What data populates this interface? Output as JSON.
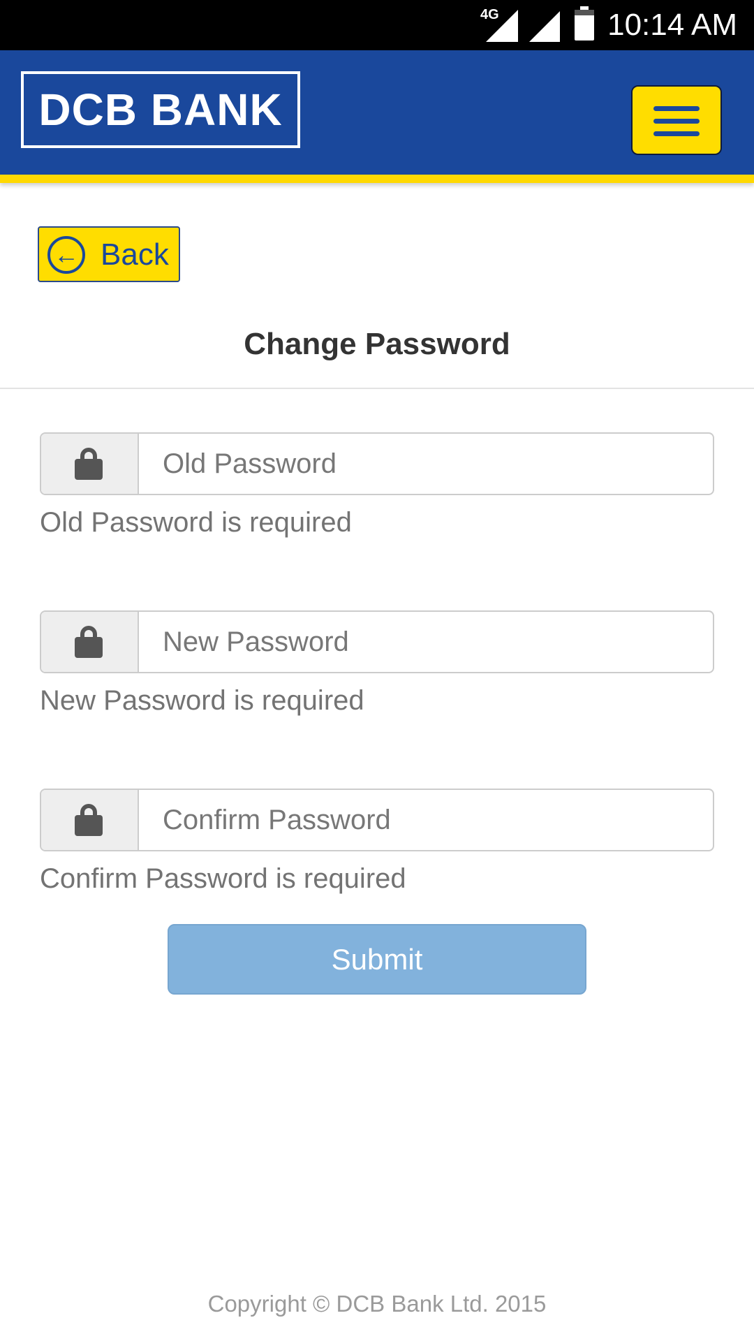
{
  "status_bar": {
    "network_label": "4G",
    "time": "10:14 AM",
    "icons": [
      "signal-4g-icon",
      "signal-icon",
      "battery-icon"
    ]
  },
  "header": {
    "logo_text": "DCB BANK",
    "menu_icon": "hamburger-menu-icon",
    "brand_color": "#1a489c",
    "accent_color": "#ffdd00"
  },
  "back_button": {
    "label": "Back",
    "icon": "arrow-left-circle-icon"
  },
  "page_title": "Change Password",
  "form": {
    "fields": [
      {
        "placeholder": "Old Password",
        "value": "",
        "icon": "lock-icon",
        "error": "Old Password is required"
      },
      {
        "placeholder": "New Password",
        "value": "",
        "icon": "lock-icon",
        "error": "New Password is required"
      },
      {
        "placeholder": "Confirm Password",
        "value": "",
        "icon": "lock-icon",
        "error": "Confirm Password is required"
      }
    ],
    "submit_label": "Submit",
    "submit_color": "#82b2dc"
  },
  "footer": {
    "copyright": "Copyright © DCB Bank Ltd. 2015"
  }
}
